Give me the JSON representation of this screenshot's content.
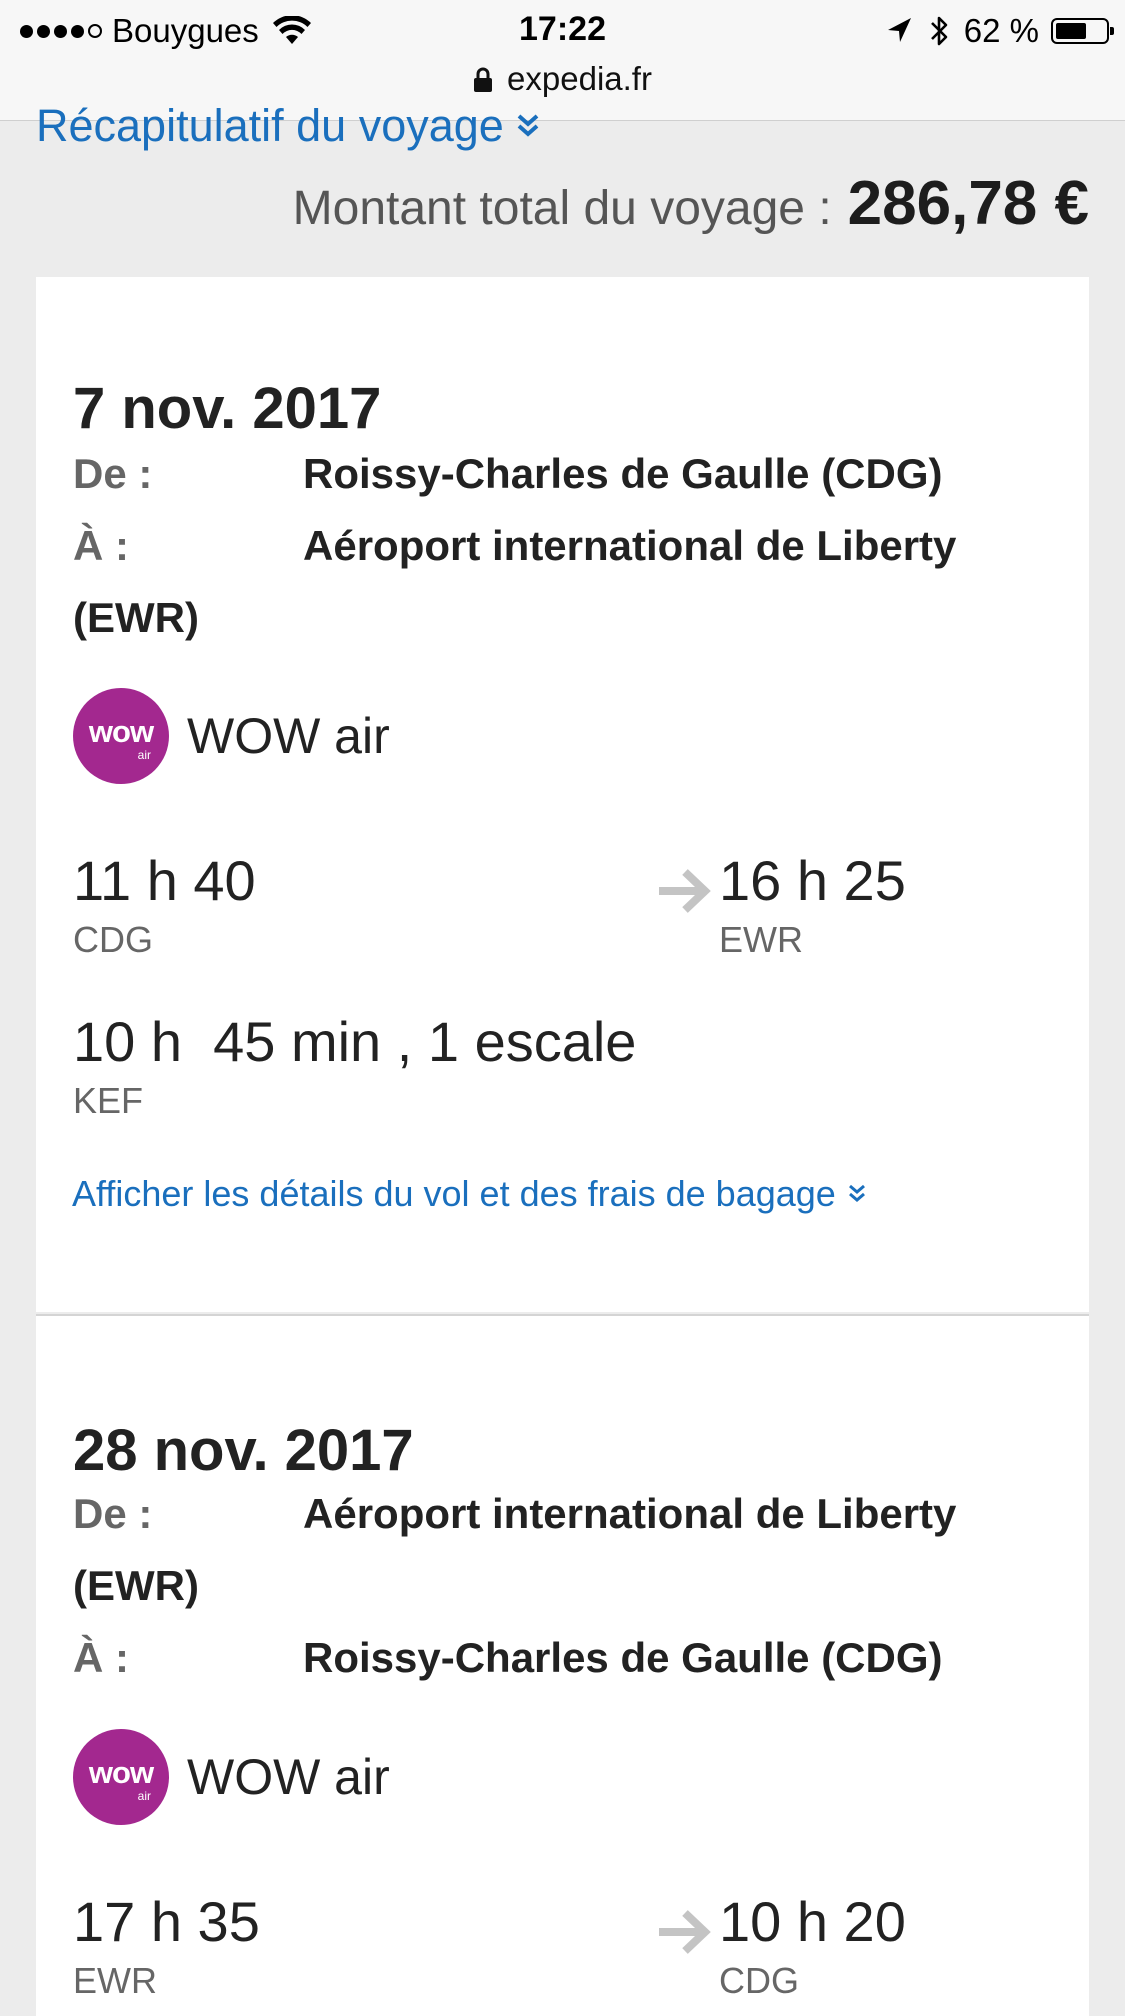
{
  "status_bar": {
    "carrier": "Bouygues",
    "time": "17:22",
    "battery_percent": "62 %",
    "battery_level": 0.62,
    "url": "expedia.fr",
    "signal_bars_filled": 4,
    "signal_bars_total": 5
  },
  "summary": {
    "link_label": "Récapitulatif du voyage",
    "total_label": "Montant total du voyage :",
    "total_amount": "286,78 €"
  },
  "flights": [
    {
      "date": "7 nov. 2017",
      "from_label": "De :",
      "from_value": "Roissy-Charles de Gaulle (CDG)",
      "to_label": "À :",
      "to_value_line1": "Aéroport international de Liberty",
      "to_value_line2": "(EWR)",
      "airline": "WOW air",
      "logo_text": "wow",
      "logo_sub": "air",
      "depart_time": "11 h 40",
      "depart_code": "CDG",
      "arrive_time": "16 h 25",
      "arrive_code": "EWR",
      "duration": "10 h  45 min , 1 escale",
      "stop_code": "KEF",
      "details_link": "Afficher les détails du vol et des frais de bagage"
    },
    {
      "date": "28 nov. 2017",
      "from_label": "De :",
      "from_value_line1": "Aéroport international de Liberty",
      "from_value_line2": "(EWR)",
      "to_label": "À :",
      "to_value": "Roissy-Charles de Gaulle (CDG)",
      "airline": "WOW air",
      "logo_text": "wow",
      "logo_sub": "air",
      "depart_time": "17 h 35",
      "depart_code": "EWR",
      "arrive_time": "10 h 20",
      "arrive_code": "CDG"
    }
  ],
  "colors": {
    "link": "#1a6fbd",
    "wow_brand": "#a3288f",
    "page_bg": "#ececec"
  },
  "icons": [
    "wifi-icon",
    "location-arrow-icon",
    "bluetooth-icon",
    "battery-icon",
    "lock-icon",
    "chevron-double-down-icon",
    "arrow-right-icon"
  ]
}
